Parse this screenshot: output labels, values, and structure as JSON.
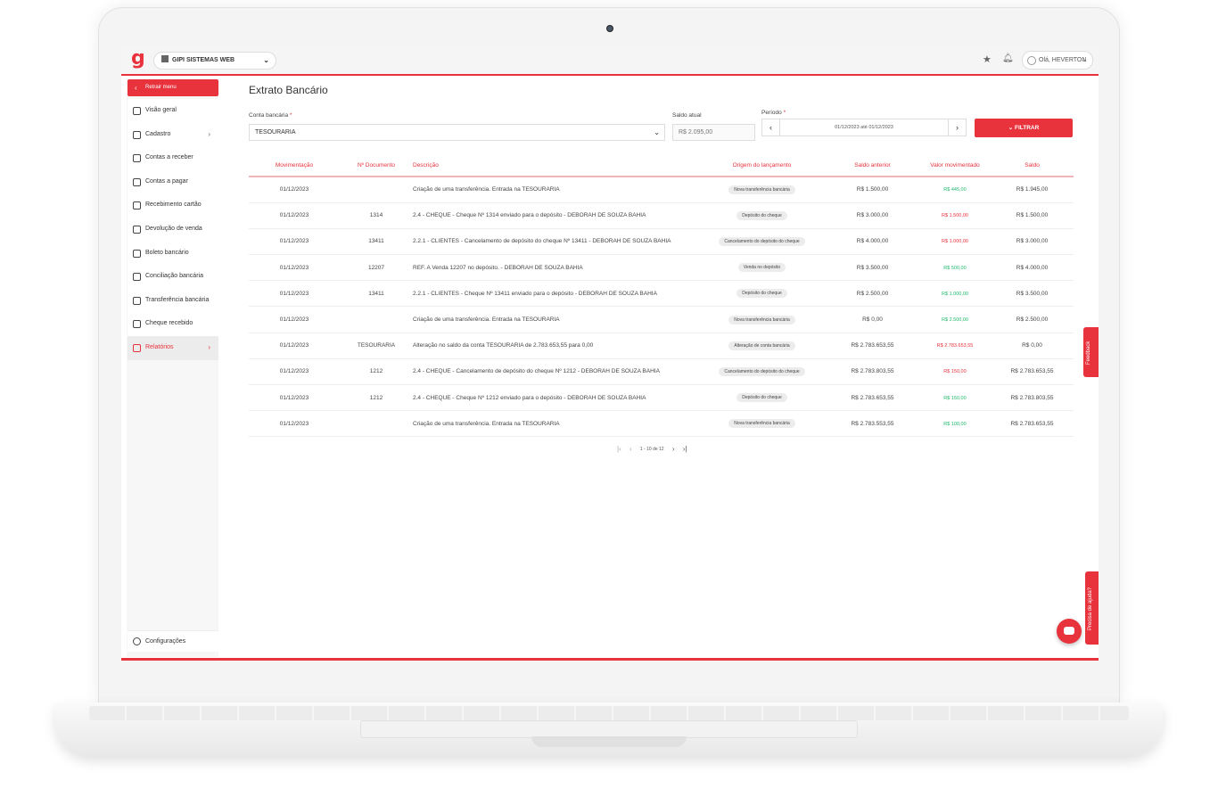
{
  "topbar": {
    "logo": "g",
    "company": "GIPI SISTEMAS WEB",
    "user_greeting": "Olá, HEVERTON"
  },
  "sidebar": {
    "collapse_label": "Retrair menu",
    "items": [
      {
        "label": "Visão geral",
        "icon": "home-icon"
      },
      {
        "label": "Cadastro",
        "icon": "register-icon"
      },
      {
        "label": "Contas a receber",
        "icon": "receive-icon"
      },
      {
        "label": "Contas a pagar",
        "icon": "pay-icon"
      },
      {
        "label": "Recebimento cartão",
        "icon": "card-icon"
      },
      {
        "label": "Devolução de venda",
        "icon": "return-icon"
      },
      {
        "label": "Boleto bancário",
        "icon": "boleto-icon"
      },
      {
        "label": "Conciliação bancária",
        "icon": "reconcile-icon"
      },
      {
        "label": "Transferência bancária",
        "icon": "transfer-icon"
      },
      {
        "label": "Cheque recebido",
        "icon": "cheque-icon"
      },
      {
        "label": "Relatórios",
        "icon": "chart-icon"
      }
    ],
    "config_label": "Configurações"
  },
  "main": {
    "title": "Extrato Bancário",
    "account_label": "Conta bancária",
    "account_value": "TESOURARIA",
    "balance_label": "Saldo atual",
    "balance_value": "R$ 2.095,00",
    "period_label": "Período",
    "period_value": "01/12/2023 até 01/12/2023",
    "filter_label": "FILTRAR"
  },
  "table": {
    "headers": [
      "Movimentação",
      "Nº Documento",
      "Descrição",
      "Origem do lançamento",
      "Saldo anterior",
      "Valor movimentado",
      "Saldo"
    ],
    "rows": [
      {
        "date": "01/12/2023",
        "doc": "",
        "desc": "Criação de uma transferência. Entrada na TESOURARIA",
        "origin": "Nova transferência bancária",
        "prev": "R$ 1.500,00",
        "value": "R$ 445,00",
        "positive": true,
        "balance": "R$ 1.945,00"
      },
      {
        "date": "01/12/2023",
        "doc": "1314",
        "desc": "2.4 - CHEQUE - Cheque Nº 1314 enviado para o depósito - DEBORAH DE SOUZA BAHIA",
        "origin": "Depósito do cheque",
        "prev": "R$ 3.000,00",
        "value": "R$ 1.500,00",
        "positive": false,
        "balance": "R$ 1.500,00"
      },
      {
        "date": "01/12/2023",
        "doc": "13411",
        "desc": "2.2.1 - CLIENTES - Cancelamento de depósito do cheque Nº 13411 - DEBORAH DE SOUZA BAHIA",
        "origin": "Cancelamento do depósito do cheque",
        "prev": "R$ 4.000,00",
        "value": "R$ 1.000,00",
        "positive": false,
        "balance": "R$ 3.000,00"
      },
      {
        "date": "01/12/2023",
        "doc": "12207",
        "desc": "REF. A Venda 12207 no depósito. - DEBORAH DE SOUZA BAHIA",
        "origin": "Venda no depósito",
        "prev": "R$ 3.500,00",
        "value": "R$ 500,00",
        "positive": true,
        "balance": "R$ 4.000,00"
      },
      {
        "date": "01/12/2023",
        "doc": "13411",
        "desc": "2.2.1 - CLIENTES - Cheque Nº 13411 enviado para o depósito - DEBORAH DE SOUZA BAHIA",
        "origin": "Depósito do cheque",
        "prev": "R$ 2.500,00",
        "value": "R$ 1.000,00",
        "positive": true,
        "balance": "R$ 3.500,00"
      },
      {
        "date": "01/12/2023",
        "doc": "",
        "desc": "Criação de uma transferência. Entrada na TESOURARIA",
        "origin": "Nova transferência bancária",
        "prev": "R$ 0,00",
        "value": "R$ 2.500,00",
        "positive": true,
        "balance": "R$ 2.500,00"
      },
      {
        "date": "01/12/2023",
        "doc": "TESOURARIA",
        "desc": "Alteração no saldo da conta TESOURARIA de 2.783.653,55 para 0,00",
        "origin": "Alteração de conta bancária",
        "prev": "R$ 2.783.653,55",
        "value": "R$ 2.783.653,55",
        "positive": false,
        "balance": "R$ 0,00"
      },
      {
        "date": "01/12/2023",
        "doc": "1212",
        "desc": "2.4 - CHEQUE - Cancelamento de depósito do cheque Nº 1212 - DEBORAH DE SOUZA BAHIA",
        "origin": "Cancelamento do depósito do cheque",
        "prev": "R$ 2.783.803,55",
        "value": "R$ 150,00",
        "positive": false,
        "balance": "R$ 2.783.653,55"
      },
      {
        "date": "01/12/2023",
        "doc": "1212",
        "desc": "2.4 - CHEQUE - Cheque Nº 1212 enviado para o depósito - DEBORAH DE SOUZA BAHIA",
        "origin": "Depósito do cheque",
        "prev": "R$ 2.783.653,55",
        "value": "R$ 150,00",
        "positive": true,
        "balance": "R$ 2.783.803,55"
      },
      {
        "date": "01/12/2023",
        "doc": "",
        "desc": "Criação de uma transferência. Entrada na TESOURARIA",
        "origin": "Nova transferência bancária",
        "prev": "R$ 2.783.553,55",
        "value": "R$ 100,00",
        "positive": true,
        "balance": "R$ 2.783.653,55"
      }
    ]
  },
  "pagination": {
    "range_text": "1 - 10 de 12"
  },
  "widgets": {
    "feedback_label": "Feedback",
    "help_label": "Precisa de ajuda?"
  },
  "colors": {
    "accent": "#e8323c",
    "positive": "#1fb86a",
    "negative": "#e8323c"
  }
}
